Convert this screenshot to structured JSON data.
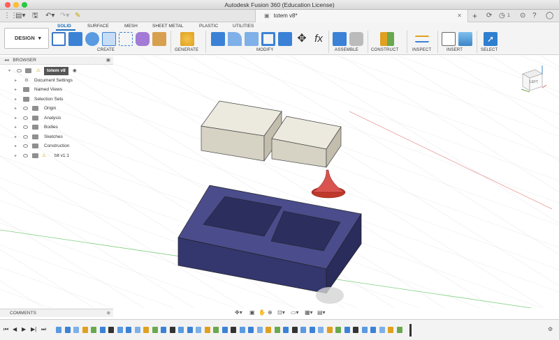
{
  "window": {
    "title": "Autodesk Fusion 360 (Education License)",
    "doc_tab": "totem v8*",
    "notifications": "1",
    "traffic_lights": [
      "#ff5f57",
      "#ffbd2e",
      "#28c840"
    ]
  },
  "ribbon": {
    "workspace": "DESIGN",
    "tabs": [
      "SOLID",
      "SURFACE",
      "MESH",
      "SHEET METAL",
      "PLASTIC",
      "UTILITIES"
    ],
    "active_tab": "SOLID",
    "groups": [
      "CREATE",
      "GENERATE",
      "MODIFY",
      "ASSEMBLE",
      "CONSTRUCT",
      "INSPECT",
      "INSERT",
      "SELECT"
    ],
    "accent": "#1a6fc2"
  },
  "browser": {
    "title": "BROWSER",
    "root": "totem v8",
    "items": [
      "Document Settings",
      "Named Views",
      "Selection Sets",
      "Origin",
      "Analysis",
      "Bodies",
      "Sketches",
      "Construction",
      "bit v1:1"
    ]
  },
  "comments": {
    "title": "COMMENTS"
  },
  "viewcube": {
    "face": "LEFT"
  },
  "model_colors": {
    "base": "#3b3d7a",
    "blocks": "#e4e0d4",
    "bit": "#c0392b"
  }
}
